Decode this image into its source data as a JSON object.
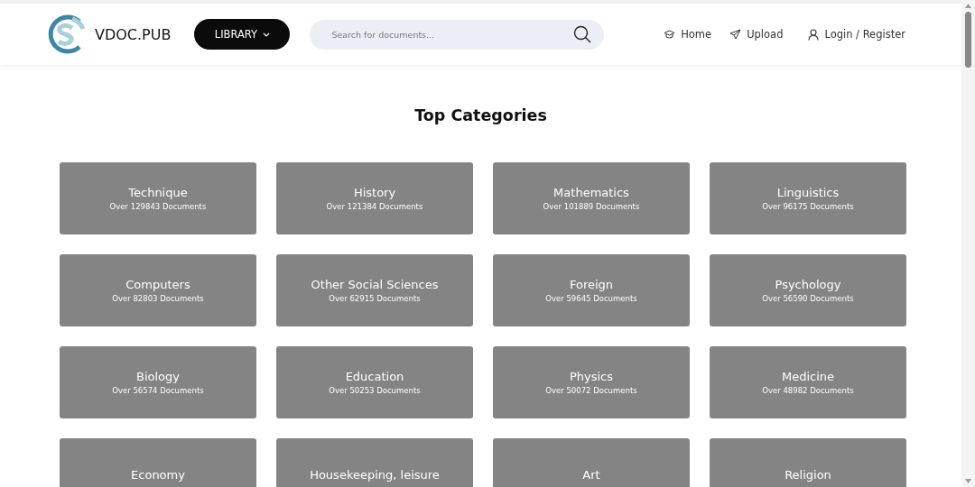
{
  "header": {
    "logo_text": "VDOC.PUB",
    "library_button": "LIBRARY",
    "search": {
      "placeholder": "Search for documents..."
    },
    "nav": [
      {
        "label": "Home",
        "kind": "home"
      },
      {
        "label": "Upload",
        "kind": "upload"
      },
      {
        "label": "Login / Register",
        "kind": "user"
      }
    ]
  },
  "section_title": "Top Categories",
  "categories": [
    {
      "name": "Technique",
      "count": "Over 129843 Documents"
    },
    {
      "name": "History",
      "count": "Over 121384 Documents"
    },
    {
      "name": "Mathematics",
      "count": "Over 101889 Documents"
    },
    {
      "name": "Linguistics",
      "count": "Over 96175 Documents"
    },
    {
      "name": "Computers",
      "count": "Over 82803 Documents"
    },
    {
      "name": "Other Social Sciences",
      "count": "Over 62915 Documents"
    },
    {
      "name": "Foreign",
      "count": "Over 59645 Documents"
    },
    {
      "name": "Psychology",
      "count": "Over 56590 Documents"
    },
    {
      "name": "Biology",
      "count": "Over 56574 Documents"
    },
    {
      "name": "Education",
      "count": "Over 50253 Documents"
    },
    {
      "name": "Physics",
      "count": "Over 50072 Documents"
    },
    {
      "name": "Medicine",
      "count": "Over 48982 Documents"
    },
    {
      "name": "Economy"
    },
    {
      "name": "Housekeeping, leisure"
    },
    {
      "name": "Art"
    },
    {
      "name": "Religion"
    }
  ]
}
